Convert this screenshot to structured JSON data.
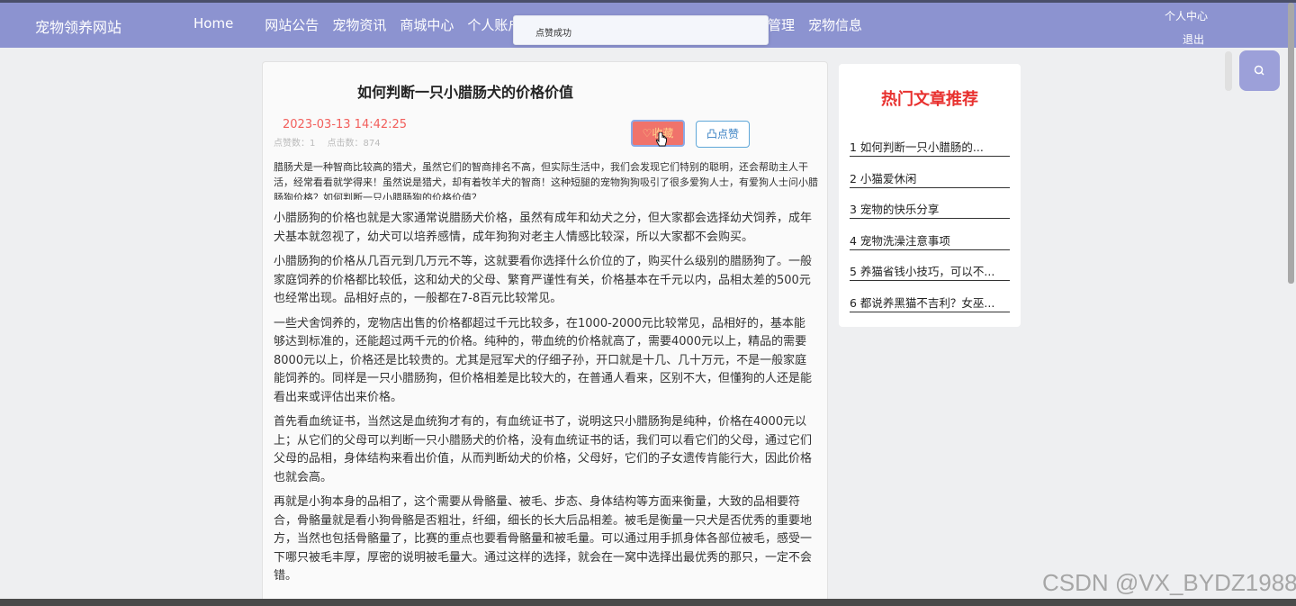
{
  "header": {
    "brand": "宠物领养网站",
    "nav_left": [
      "Home",
      "网站公告",
      "宠物资讯",
      "商城中心",
      "个人账户"
    ],
    "nav_right": [
      "管理",
      "宠物信息"
    ],
    "user_center": "个人中心",
    "logout": "退出"
  },
  "toast": {
    "message": "点赞成功"
  },
  "article": {
    "title": "如何判断一只小腊肠犬的价格价值",
    "date": "2023-03-13 14:42:25",
    "like_count_label": "点赞数：1",
    "click_count_label": "点击数：874",
    "collect_label": "♡收藏",
    "like_label": "凸点赞",
    "summary": "腊肠犬是一种智商比较高的猎犬，虽然它们的智商排名不高，但实际生活中，我们会发现它们特别的聪明，还会帮助主人干活，经常看看就学得来！虽然说是猎犬，却有着牧羊犬的智商！这种短腿的宠物狗狗吸引了很多爱狗人士，有爱狗人士问小腊肠狗价格？如何判断一只小腊肠狗的价格价值？",
    "paragraphs": [
      "小腊肠狗的价格也就是大家通常说腊肠犬价格，虽然有成年和幼犬之分，但大家都会选择幼犬饲养，成年犬基本就忽视了，幼犬可以培养感情，成年狗狗对老主人情感比较深，所以大家都不会购买。",
      "  小腊肠狗的价格从几百元到几万元不等，这就要看你选择什么价位的了，购买什么级别的腊肠狗了。一般家庭饲养的价格都比较低，这和幼犬的父母、繁育严谨性有关，价格基本在千元以内，品相太差的500元也经常出现。品相好点的，一般都在7-8百元比较常见。",
      "  一些犬舍饲养的，宠物店出售的价格都超过千元比较多，在1000-2000元比较常见，品相好的，基本能够达到标准的，还能超过两千元的价格。纯种的，带血统的价格就高了，需要4000元以上，精品的需要8000元以上，价格还是比较贵的。尤其是冠军犬的仔细子孙，开口就是十几、几十万元，不是一般家庭能饲养的。同样是一只小腊肠狗，但价格相差是比较大的，在普通人看来，区别不大，但懂狗的人还是能看出来或评估出来价格。",
      "  首先看血统证书，当然这是血统狗才有的，有血统证书了，说明这只小腊肠狗是纯种，价格在4000元以上；从它们的父母可以判断一只小腊肠犬的价格，没有血统证书的话，我们可以看它们的父母，通过它们父母的品相，身体结构来看出价值，从而判断幼犬的价格，父母好，它们的子女遗传肯能行大，因此价格也就会高。",
      "再就是小狗本身的品相了，这个需要从骨骼量、被毛、步态、身体结构等方面来衡量，大致的品相要符合，骨骼量就是看小狗骨骼是否粗壮，纤细，细长的长大后品相差。被毛是衡量一只犬是否优秀的重要地方，当然也包括骨骼量了，比赛的重点也要看骨骼量和被毛量。可以通过用手抓身体各部位被毛，感受一下哪只被毛丰厚，厚密的说明被毛量大。通过这样的选择，就会在一窝中选择出最优秀的那只，一定不会错。"
    ]
  },
  "sidebar": {
    "title": "热门文章推荐",
    "items": [
      "1 如何判断一只小腊肠的...",
      "2 小猫爱休闲",
      "3 宠物的快乐分享",
      "4 宠物洗澡注意事项",
      "5 养猫省钱小技巧，可以不...",
      "6 都说养黑猫不吉利？女巫..."
    ]
  },
  "watermark": "CSDN @VX_BYDZ1988"
}
